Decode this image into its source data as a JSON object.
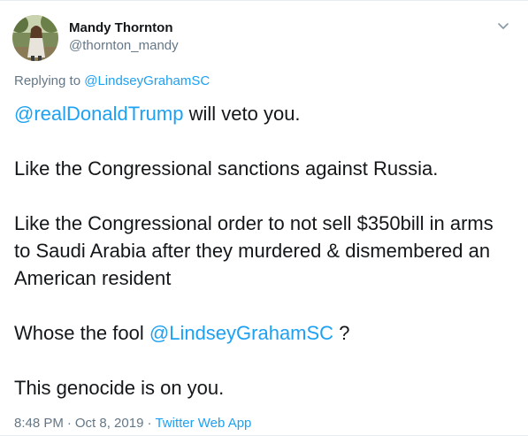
{
  "author": {
    "name": "Mandy Thornton",
    "handle": "@thornton_mandy"
  },
  "reply": {
    "prefix": "Replying to",
    "to": "@LindseyGrahamSC"
  },
  "tweet": {
    "p1_mention": "@realDonaldTrump",
    "p1_text": " will veto you.",
    "p2": "Like the Congressional sanctions against Russia.",
    "p3": "Like the Congressional order to not sell $350bill in arms to Saudi Arabia after they murdered & dismembered an American resident",
    "p4_pre": "Whose the fool ",
    "p4_mention": "@LindseyGrahamSC",
    "p4_post": " ?",
    "p5": "This genocide is on you."
  },
  "meta": {
    "time": "8:48 PM",
    "dot1": "·",
    "date": "Oct 8, 2019",
    "dot2": "·",
    "source": "Twitter Web App"
  },
  "icons": {
    "caret": "chevron-down-icon",
    "avatar": "avatar-photo"
  },
  "colors": {
    "link": "#1da1f2",
    "secondary": "#657786",
    "text": "#14171a"
  }
}
